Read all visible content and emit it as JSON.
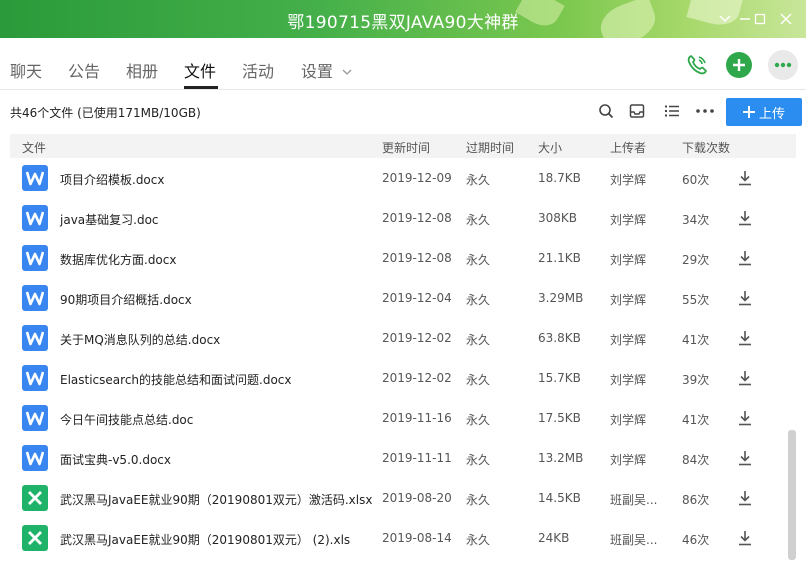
{
  "window": {
    "title": "鄂190715黑双JAVA90大神群",
    "controls": [
      "chevron-down-icon",
      "minimize-icon",
      "maximize-icon",
      "close-icon"
    ]
  },
  "nav": {
    "tabs": [
      {
        "label": "聊天"
      },
      {
        "label": "公告"
      },
      {
        "label": "相册"
      },
      {
        "label": "文件",
        "active": true
      },
      {
        "label": "活动"
      },
      {
        "label": "设置"
      }
    ],
    "actions": [
      "phone-icon",
      "add-icon",
      "more-icon"
    ]
  },
  "toolbar": {
    "summary": "共46个文件 (已使用171MB/10GB)",
    "icons": [
      "search-icon",
      "inbox-icon",
      "list-view-icon",
      "more-icon"
    ],
    "upload_label": "上传"
  },
  "columns": {
    "file": "文件",
    "updated": "更新时间",
    "expiry": "过期时间",
    "size": "大小",
    "uploader": "上传者",
    "downloads": "下载次数"
  },
  "files": [
    {
      "name": "项目介绍模板.docx",
      "type": "word",
      "updated": "2019-12-09",
      "expiry": "永久",
      "size": "18.7KB",
      "uploader": "刘学辉",
      "downloads": "60次"
    },
    {
      "name": "java基础复习.doc",
      "type": "word",
      "updated": "2019-12-08",
      "expiry": "永久",
      "size": "308KB",
      "uploader": "刘学辉",
      "downloads": "34次"
    },
    {
      "name": "数据库优化方面.docx",
      "type": "word",
      "updated": "2019-12-08",
      "expiry": "永久",
      "size": "21.1KB",
      "uploader": "刘学辉",
      "downloads": "29次"
    },
    {
      "name": "90期项目介绍概括.docx",
      "type": "word",
      "updated": "2019-12-04",
      "expiry": "永久",
      "size": "3.29MB",
      "uploader": "刘学辉",
      "downloads": "55次"
    },
    {
      "name": "关于MQ消息队列的总结.docx",
      "type": "word",
      "updated": "2019-12-02",
      "expiry": "永久",
      "size": "63.8KB",
      "uploader": "刘学辉",
      "downloads": "41次"
    },
    {
      "name": "Elasticsearch的技能总结和面试问题.docx",
      "type": "word",
      "updated": "2019-12-02",
      "expiry": "永久",
      "size": "15.7KB",
      "uploader": "刘学辉",
      "downloads": "39次"
    },
    {
      "name": "今日午间技能点总结.doc",
      "type": "word",
      "updated": "2019-11-16",
      "expiry": "永久",
      "size": "17.5KB",
      "uploader": "刘学辉",
      "downloads": "41次"
    },
    {
      "name": "面试宝典-v5.0.docx",
      "type": "word",
      "updated": "2019-11-11",
      "expiry": "永久",
      "size": "13.2MB",
      "uploader": "刘学辉",
      "downloads": "84次"
    },
    {
      "name": "武汉黑马JavaEE就业90期（20190801双元）激活码.xlsx",
      "type": "excel",
      "updated": "2019-08-20",
      "expiry": "永久",
      "size": "14.5KB",
      "uploader": "班副吴...",
      "downloads": "86次"
    },
    {
      "name": "武汉黑马JavaEE就业90期（20190801双元） (2).xls",
      "type": "excel",
      "updated": "2019-08-14",
      "expiry": "永久",
      "size": "24KB",
      "uploader": "班副吴...",
      "downloads": "46次"
    }
  ],
  "colors": {
    "word": "#3a86f0",
    "excel": "#1fb36a",
    "accent": "#2c8df0",
    "green": "#2ea84a"
  }
}
